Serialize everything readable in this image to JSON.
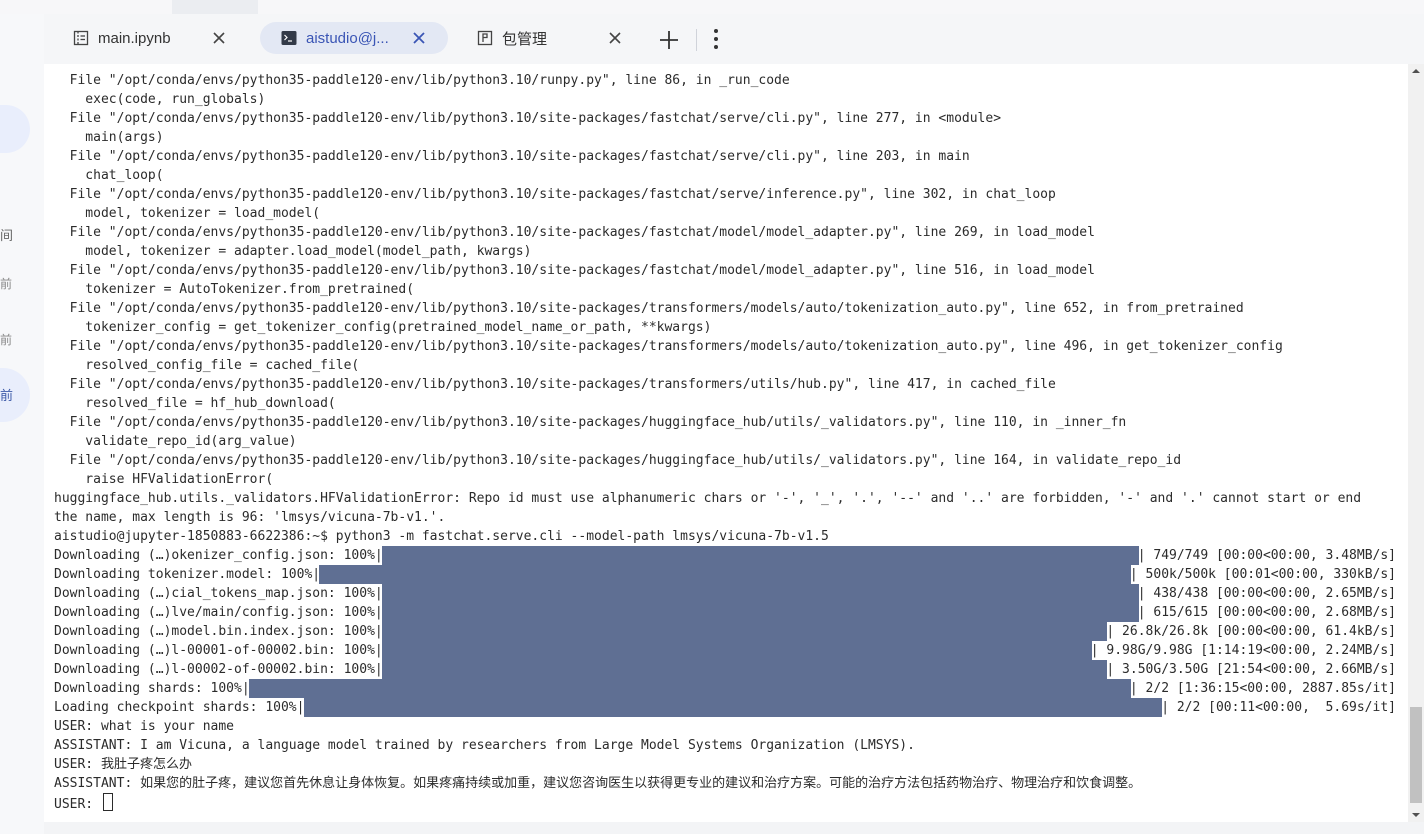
{
  "tabs": [
    {
      "label": "main.ipynb",
      "icon": "notebook-icon"
    },
    {
      "label": "aistudio@j...",
      "icon": "terminal-icon"
    },
    {
      "label": "包管理",
      "icon": "package-icon"
    }
  ],
  "sidebar": {
    "items": [
      "间",
      "前",
      "前",
      "前"
    ]
  },
  "terminal": {
    "trace": [
      "  File \"/opt/conda/envs/python35-paddle120-env/lib/python3.10/runpy.py\", line 86, in _run_code",
      "    exec(code, run_globals)",
      "  File \"/opt/conda/envs/python35-paddle120-env/lib/python3.10/site-packages/fastchat/serve/cli.py\", line 277, in <module>",
      "    main(args)",
      "  File \"/opt/conda/envs/python35-paddle120-env/lib/python3.10/site-packages/fastchat/serve/cli.py\", line 203, in main",
      "    chat_loop(",
      "  File \"/opt/conda/envs/python35-paddle120-env/lib/python3.10/site-packages/fastchat/serve/inference.py\", line 302, in chat_loop",
      "    model, tokenizer = load_model(",
      "  File \"/opt/conda/envs/python35-paddle120-env/lib/python3.10/site-packages/fastchat/model/model_adapter.py\", line 269, in load_model",
      "    model, tokenizer = adapter.load_model(model_path, kwargs)",
      "  File \"/opt/conda/envs/python35-paddle120-env/lib/python3.10/site-packages/fastchat/model/model_adapter.py\", line 516, in load_model",
      "    tokenizer = AutoTokenizer.from_pretrained(",
      "  File \"/opt/conda/envs/python35-paddle120-env/lib/python3.10/site-packages/transformers/models/auto/tokenization_auto.py\", line 652, in from_pretrained",
      "    tokenizer_config = get_tokenizer_config(pretrained_model_name_or_path, **kwargs)",
      "  File \"/opt/conda/envs/python35-paddle120-env/lib/python3.10/site-packages/transformers/models/auto/tokenization_auto.py\", line 496, in get_tokenizer_config",
      "    resolved_config_file = cached_file(",
      "  File \"/opt/conda/envs/python35-paddle120-env/lib/python3.10/site-packages/transformers/utils/hub.py\", line 417, in cached_file",
      "    resolved_file = hf_hub_download(",
      "  File \"/opt/conda/envs/python35-paddle120-env/lib/python3.10/site-packages/huggingface_hub/utils/_validators.py\", line 110, in _inner_fn",
      "    validate_repo_id(arg_value)",
      "  File \"/opt/conda/envs/python35-paddle120-env/lib/python3.10/site-packages/huggingface_hub/utils/_validators.py\", line 164, in validate_repo_id",
      "    raise HFValidationError(",
      "huggingface_hub.utils._validators.HFValidationError: Repo id must use alphanumeric chars or '-', '_', '.', '--' and '..' are forbidden, '-' and '.' cannot start or end",
      "the name, max length is 96: 'lmsys/vicuna-7b-v1.'.",
      "aistudio@jupyter-1850883-6622386:~$ python3 -m fastchat.serve.cli --model-path lmsys/vicuna-7b-v1.5"
    ],
    "downloads": [
      {
        "label": "Downloading (…)okenizer_config.json: 100%|",
        "stats": "| 749/749 [00:00<00:00, 3.48MB/s]",
        "progress": 1.0
      },
      {
        "label": "Downloading tokenizer.model: 100%|",
        "stats": "| 500k/500k [00:01<00:00, 330kB/s]",
        "progress": 1.0
      },
      {
        "label": "Downloading (…)cial_tokens_map.json: 100%|",
        "stats": "| 438/438 [00:00<00:00, 2.65MB/s]",
        "progress": 1.0
      },
      {
        "label": "Downloading (…)lve/main/config.json: 100%|",
        "stats": "| 615/615 [00:00<00:00, 2.68MB/s]",
        "progress": 1.0
      },
      {
        "label": "Downloading (…)model.bin.index.json: 100%|",
        "stats": "| 26.8k/26.8k [00:00<00:00, 61.4kB/s]",
        "progress": 1.0
      },
      {
        "label": "Downloading (…)l-00001-of-00002.bin: 100%|",
        "stats": "| 9.98G/9.98G [1:14:19<00:00, 2.24MB/s]",
        "progress": 1.0
      },
      {
        "label": "Downloading (…)l-00002-of-00002.bin: 100%|",
        "stats": "| 3.50G/3.50G [21:54<00:00, 2.66MB/s]",
        "progress": 1.0
      },
      {
        "label": "Downloading shards: 100%|",
        "stats": "| 2/2 [1:36:15<00:00, 2887.85s/it]",
        "progress": 1.0
      },
      {
        "label": "Loading checkpoint shards: 100%|",
        "stats": "| 2/2 [00:11<00:00,  5.69s/it]",
        "progress": 1.0
      }
    ],
    "chat": [
      "USER: what is your name",
      "ASSISTANT: I am Vicuna, a language model trained by researchers from Large Model Systems Organization (LMSYS).",
      "USER: 我肚子疼怎么办",
      "ASSISTANT: 如果您的肚子疼，建议您首先休息让身体恢复。如果疼痛持续或加重，建议您咨询医生以获得更专业的建议和治疗方案。可能的治疗方法包括药物治疗、物理治疗和饮食调整。"
    ],
    "prompt": "USER: "
  },
  "colors": {
    "progress_bar": "#5f6f93",
    "active_tab_text": "#3a55b5",
    "active_tab_bg": "#e3e8f4"
  }
}
